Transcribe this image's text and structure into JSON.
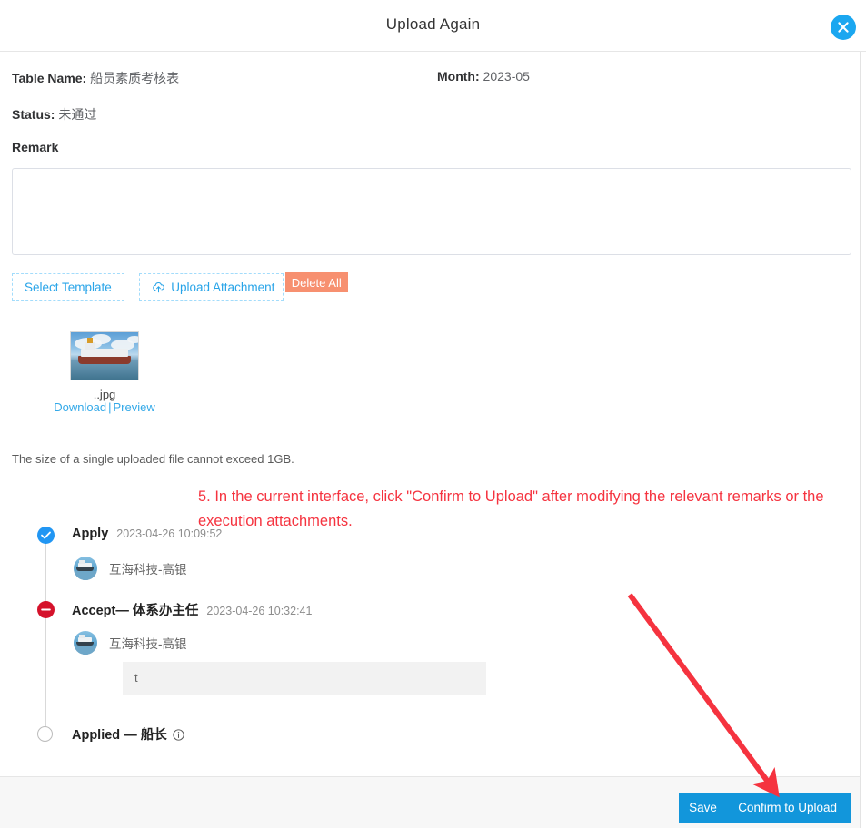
{
  "header": {
    "title": "Upload Again",
    "close_label": "×"
  },
  "form": {
    "table_name_label": "Table Name:",
    "table_name_value": "船员素质考核表",
    "month_label": "Month:",
    "month_value": "2023-05",
    "status_label": "Status:",
    "status_value": "未通过",
    "remark_label": "Remark",
    "remark_value": "",
    "remark_placeholder": ""
  },
  "actions": {
    "select_template": "Select Template",
    "upload_attachment": "Upload Attachment",
    "delete_all": "Delete All"
  },
  "attachment": {
    "filename": "..jpg",
    "download_label": "Download",
    "separator": "|",
    "preview_label": "Preview",
    "size_note": "The size of a single uploaded file cannot exceed 1GB."
  },
  "annotation": {
    "text": "5. In the current interface, click \"Confirm to Upload\" after modifying the relevant remarks or the execution attachments.",
    "color": "#f5333f",
    "arrow_color": "#f5333f"
  },
  "timeline": [
    {
      "status": "done",
      "name": "Apply",
      "time": "2023-04-26 10:09:52",
      "user": "互海科技-高银",
      "comment": null,
      "info": false
    },
    {
      "status": "reject",
      "name": "Accept— 体系办主任",
      "time": "2023-04-26 10:32:41",
      "user": "互海科技-高银",
      "comment": "t",
      "info": false
    },
    {
      "status": "pending",
      "name": "Applied — 船长",
      "time": "",
      "user": null,
      "comment": null,
      "info": true
    }
  ],
  "footer": {
    "save_label": "Save",
    "confirm_label": "Confirm to Upload",
    "primary_color": "#1296db"
  }
}
